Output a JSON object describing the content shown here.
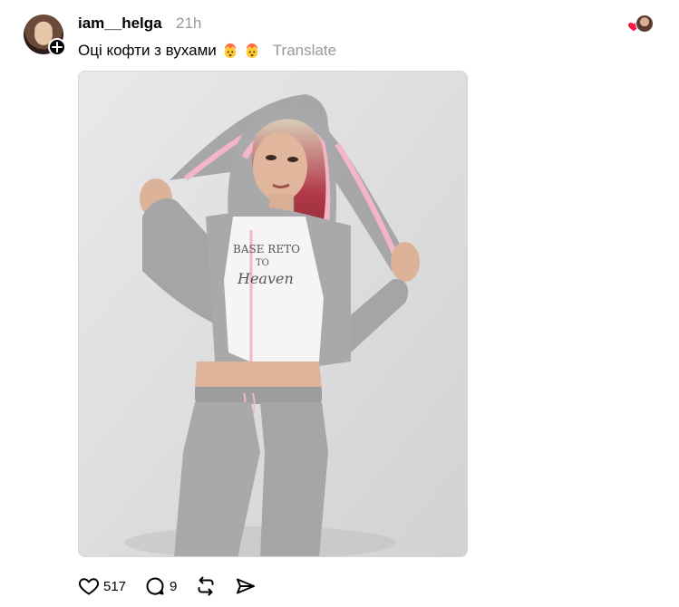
{
  "post": {
    "username": "iam__helga",
    "timestamp": "21h",
    "caption": "Оці кофти з вухами",
    "caption_emojis": [
      "exploding-head-emoji",
      "exploding-head-emoji"
    ],
    "translate_label": "Translate",
    "image": {
      "printed_text_line1": "BASE RETO",
      "printed_text_line2": "TO",
      "printed_text_line3": "Heaven"
    }
  },
  "actions": {
    "like_count": "517",
    "reply_count": "9",
    "repost_count": "",
    "share_count": ""
  },
  "icons": {
    "like": "heart-icon",
    "reply": "comment-icon",
    "repost": "repost-icon",
    "share": "send-icon",
    "follow": "plus-icon",
    "reaction": "heart-icon"
  },
  "colors": {
    "text": "#000000",
    "muted": "#999999",
    "reaction_heart": "#ff1744",
    "hoodie_gray": "#a9a9ab",
    "hoodie_lining_pink": "#f2b6c6"
  }
}
